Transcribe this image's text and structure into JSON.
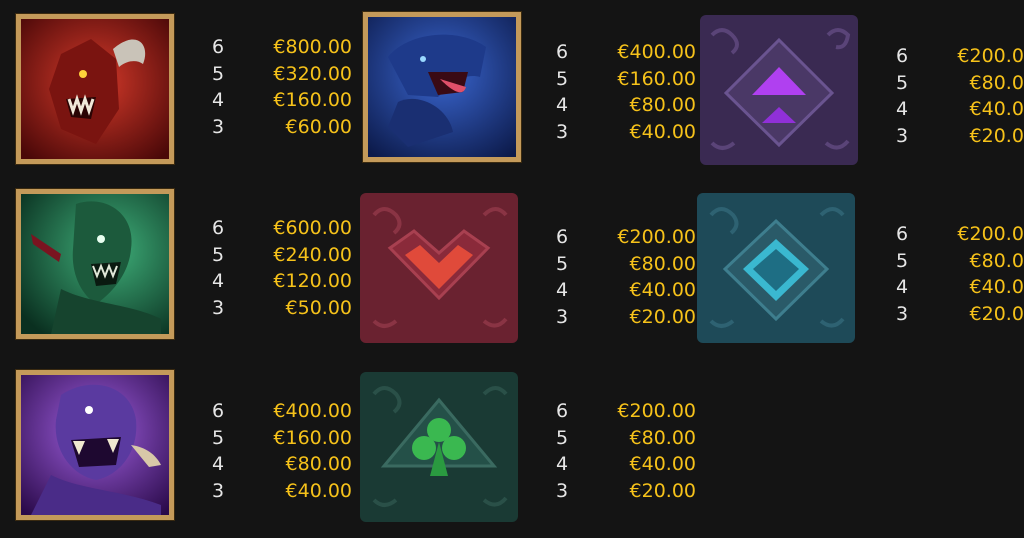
{
  "paytable": {
    "symbols": [
      {
        "name": "red-demon",
        "color": "#b02020",
        "pays": [
          {
            "count": "6",
            "value": "€800.00"
          },
          {
            "count": "5",
            "value": "€320.00"
          },
          {
            "count": "4",
            "value": "€160.00"
          },
          {
            "count": "3",
            "value": "€60.00"
          }
        ]
      },
      {
        "name": "blue-beast",
        "color": "#2a4aa8",
        "pays": [
          {
            "count": "6",
            "value": "€400.00"
          },
          {
            "count": "5",
            "value": "€160.00"
          },
          {
            "count": "4",
            "value": "€80.00"
          },
          {
            "count": "3",
            "value": "€40.00"
          }
        ]
      },
      {
        "name": "purple-diamond-rune",
        "color": "#8a2be0",
        "pays": [
          {
            "count": "6",
            "value": "€200.00"
          },
          {
            "count": "5",
            "value": "€80.00"
          },
          {
            "count": "4",
            "value": "€40.00"
          },
          {
            "count": "3",
            "value": "€20.00"
          }
        ]
      },
      {
        "name": "green-ghoul",
        "color": "#2a8a5a",
        "pays": [
          {
            "count": "6",
            "value": "€600.00"
          },
          {
            "count": "5",
            "value": "€240.00"
          },
          {
            "count": "4",
            "value": "€120.00"
          },
          {
            "count": "3",
            "value": "€50.00"
          }
        ]
      },
      {
        "name": "red-heart-rune",
        "color": "#c03030",
        "pays": [
          {
            "count": "6",
            "value": "€200.00"
          },
          {
            "count": "5",
            "value": "€80.00"
          },
          {
            "count": "4",
            "value": "€40.00"
          },
          {
            "count": "3",
            "value": "€20.00"
          }
        ]
      },
      {
        "name": "teal-diamond-rune",
        "color": "#2aa0b0",
        "pays": [
          {
            "count": "6",
            "value": "€200.00"
          },
          {
            "count": "5",
            "value": "€80.00"
          },
          {
            "count": "4",
            "value": "€40.00"
          },
          {
            "count": "3",
            "value": "€20.00"
          }
        ]
      },
      {
        "name": "purple-ogre",
        "color": "#6a3ab0",
        "pays": [
          {
            "count": "6",
            "value": "€400.00"
          },
          {
            "count": "5",
            "value": "€160.00"
          },
          {
            "count": "4",
            "value": "€80.00"
          },
          {
            "count": "3",
            "value": "€40.00"
          }
        ]
      },
      {
        "name": "green-club-rune",
        "color": "#30a050",
        "pays": [
          {
            "count": "6",
            "value": "€200.00"
          },
          {
            "count": "5",
            "value": "€80.00"
          },
          {
            "count": "4",
            "value": "€40.00"
          },
          {
            "count": "3",
            "value": "€20.00"
          }
        ]
      }
    ]
  }
}
